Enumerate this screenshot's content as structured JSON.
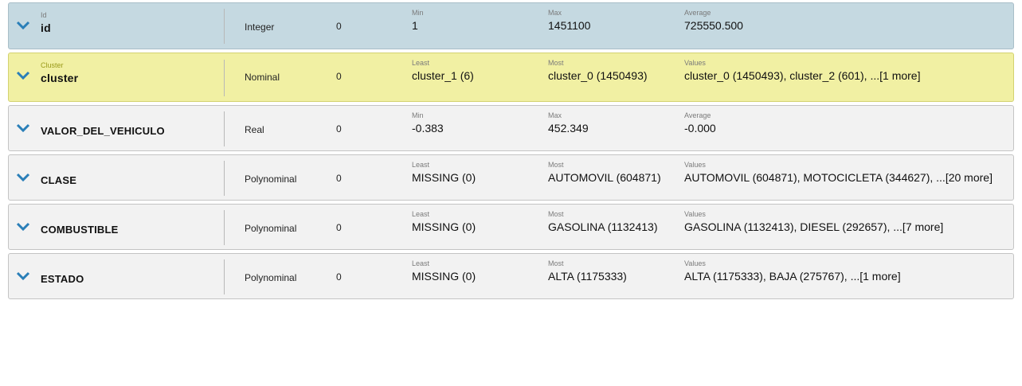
{
  "rows": [
    {
      "role": "Id",
      "name": "id",
      "type": "Integer",
      "missing": "0",
      "stats": [
        {
          "label": "Min",
          "value": "1"
        },
        {
          "label": "Max",
          "value": "1451100"
        },
        {
          "label": "Average",
          "value": "725550.500"
        }
      ]
    },
    {
      "role": "Cluster",
      "name": "cluster",
      "type": "Nominal",
      "missing": "0",
      "stats": [
        {
          "label": "Least",
          "value": "cluster_1 (6)"
        },
        {
          "label": "Most",
          "value": "cluster_0 (1450493)"
        },
        {
          "label": "Values",
          "value": "cluster_0 (1450493), cluster_2 (601), ...[1 more]"
        }
      ]
    },
    {
      "role": "",
      "name": "VALOR_DEL_VEHICULO",
      "type": "Real",
      "missing": "0",
      "stats": [
        {
          "label": "Min",
          "value": "-0.383"
        },
        {
          "label": "Max",
          "value": "452.349"
        },
        {
          "label": "Average",
          "value": "-0.000"
        }
      ]
    },
    {
      "role": "",
      "name": "CLASE",
      "type": "Polynominal",
      "missing": "0",
      "stats": [
        {
          "label": "Least",
          "value": "MISSING (0)"
        },
        {
          "label": "Most",
          "value": "AUTOMOVIL (604871)"
        },
        {
          "label": "Values",
          "value": "AUTOMOVIL (604871), MOTOCICLETA (344627), ...[20 more]"
        }
      ]
    },
    {
      "role": "",
      "name": "COMBUSTIBLE",
      "type": "Polynominal",
      "missing": "0",
      "stats": [
        {
          "label": "Least",
          "value": "MISSING (0)"
        },
        {
          "label": "Most",
          "value": "GASOLINA (1132413)"
        },
        {
          "label": "Values",
          "value": "GASOLINA (1132413), DIESEL (292657), ...[7 more]"
        }
      ]
    },
    {
      "role": "",
      "name": "ESTADO",
      "type": "Polynominal",
      "missing": "0",
      "stats": [
        {
          "label": "Least",
          "value": "MISSING (0)"
        },
        {
          "label": "Most",
          "value": "ALTA (1175333)"
        },
        {
          "label": "Values",
          "value": "ALTA (1175333), BAJA (275767), ...[1 more]"
        }
      ]
    }
  ],
  "colors": {
    "id_row_bg": "#c5d9e1",
    "cluster_row_bg": "#f1f0a3",
    "regular_row_bg": "#f2f2f2",
    "chevron": "#2a7fb8"
  },
  "icons": {
    "expand": "chevron-down-icon"
  }
}
